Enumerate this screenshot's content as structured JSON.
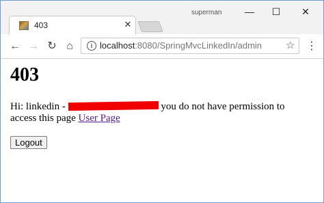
{
  "browser": {
    "tab": {
      "title": "403",
      "favicon": "site-favicon",
      "close_glyph": "✕"
    },
    "profile_name": "superman",
    "window_controls": {
      "minimize": "—",
      "maximize": "☐",
      "close": "✕"
    },
    "toolbar": {
      "back": "←",
      "forward": "→",
      "reload": "↻",
      "home": "⌂",
      "info": "i",
      "star": "☆",
      "menu": "⋮"
    },
    "address": {
      "host": "localhost",
      "rest": ":8080/SpringMvcLinkedIn/admin"
    }
  },
  "page": {
    "heading": "403",
    "message_prefix": "Hi: linkedin - ",
    "message_suffix": " you do not have permission to access this page ",
    "user_page_link": "User Page",
    "logout_button": "Logout"
  },
  "colors": {
    "redaction": "#f00000",
    "link": "#551a8b",
    "window_border": "#6f9bd1"
  }
}
